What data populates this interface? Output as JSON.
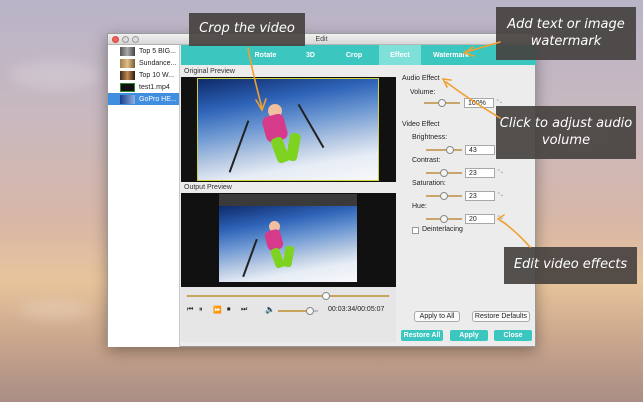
{
  "window": {
    "title": "Edit"
  },
  "files": [
    {
      "name": "Top 5 BIG..."
    },
    {
      "name": "Sundance..."
    },
    {
      "name": "Top 10 W..."
    },
    {
      "name": "test1.mp4"
    },
    {
      "name": "GoPro HE..."
    }
  ],
  "selected_file_index": 4,
  "tabs": [
    {
      "label": "Rotate"
    },
    {
      "label": "3D"
    },
    {
      "label": "Crop"
    },
    {
      "label": "Effect"
    },
    {
      "label": "Watermark"
    }
  ],
  "active_tab": "Effect",
  "preview": {
    "original_label": "Original Preview",
    "output_label": "Output Preview"
  },
  "player": {
    "time": "00:03:34/00:05:07",
    "progress": 0.69,
    "volume_level": 0.8
  },
  "audio_effect": {
    "title": "Audio Effect",
    "volume_label": "Volume:",
    "volume_value": "100%",
    "volume_level": 0.5
  },
  "video_effect": {
    "title": "Video Effect",
    "brightness_label": "Brightness:",
    "brightness_value": "43",
    "contrast_label": "Contrast:",
    "contrast_value": "23",
    "saturation_label": "Saturation:",
    "saturation_value": "23",
    "hue_label": "Hue:",
    "hue_value": "20",
    "deinterlacing_label": "Deinterlacing",
    "deinterlacing_checked": false
  },
  "buttons": {
    "apply_all": "Apply to All",
    "restore_defaults": "Restore Defaults",
    "restore_all": "Restore All",
    "apply": "Apply",
    "close": "Close"
  },
  "callouts": {
    "crop": "Crop the video",
    "watermark": "Add text or image watermark",
    "audio": "Click to adjust audio volume",
    "effects": "Edit video effects"
  },
  "colors": {
    "accent": "#3cc6c0",
    "callout_bg": "#46423f",
    "arrow": "#f0a030",
    "selection": "#3f8ee0",
    "slider": "#c9a56b"
  }
}
